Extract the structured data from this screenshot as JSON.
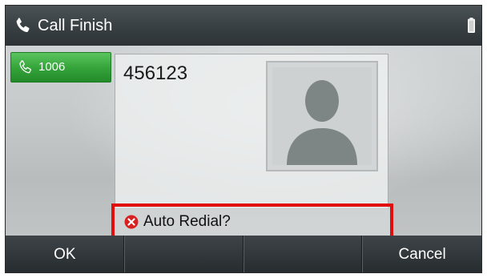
{
  "titlebar": {
    "title": "Call Finish",
    "icon": "phone-handset-icon",
    "status_icon": "battery-icon"
  },
  "line_key": {
    "label": "1006",
    "icon": "phone-handset-icon",
    "color": "#36a53b"
  },
  "call": {
    "number": "456123",
    "avatar_icon": "contact-silhouette-icon"
  },
  "prompt": {
    "text": "Auto Redial?",
    "icon": "red-x-circle-icon",
    "highlight_color": "#e20e0e"
  },
  "softkeys": [
    {
      "label": "OK"
    },
    {
      "label": ""
    },
    {
      "label": ""
    },
    {
      "label": "Cancel"
    }
  ]
}
